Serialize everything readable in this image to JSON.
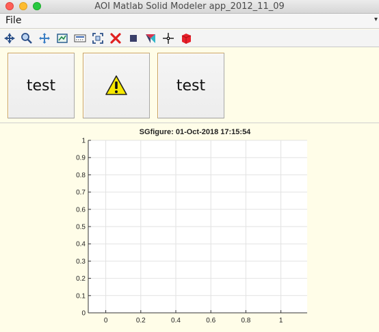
{
  "window": {
    "title": "AOI Matlab Solid Modeler app_2012_11_09"
  },
  "menu": {
    "items": [
      "File"
    ],
    "overflow_icon": "chevron-down-icon"
  },
  "toolbar": {
    "icons": [
      "data-cursor-icon",
      "zoom-icon",
      "pan-icon",
      "edit-plot-icon",
      "insert-colorbar-icon",
      "fit-view-icon",
      "delete-icon",
      "stop-icon",
      "view-axes-icon",
      "crosshair-icon",
      "red-cube-icon"
    ]
  },
  "buttons": {
    "first_label": "test",
    "second_icon": "warning-icon",
    "third_label": "test"
  },
  "figure": {
    "title": "SGfigure: 01-Oct-2018 17:15:54"
  },
  "chart_data": {
    "type": "line",
    "title": "SGfigure: 01-Oct-2018 17:15:54",
    "xlabel": "",
    "ylabel": "",
    "xlim": [
      -0.1,
      1.15
    ],
    "ylim": [
      0,
      1
    ],
    "xticks": [
      "0",
      "0.2",
      "0.4",
      "0.6",
      "0.8",
      "1"
    ],
    "yticks": [
      "0",
      "0.1",
      "0.2",
      "0.3",
      "0.4",
      "0.5",
      "0.6",
      "0.7",
      "0.8",
      "0.9",
      "1"
    ],
    "grid": true,
    "series": []
  },
  "colors": {
    "background": "#fffde8",
    "axes_background": "#ffffff",
    "grid": "#e2e2e2",
    "button_border_accent": "#c8a060"
  }
}
